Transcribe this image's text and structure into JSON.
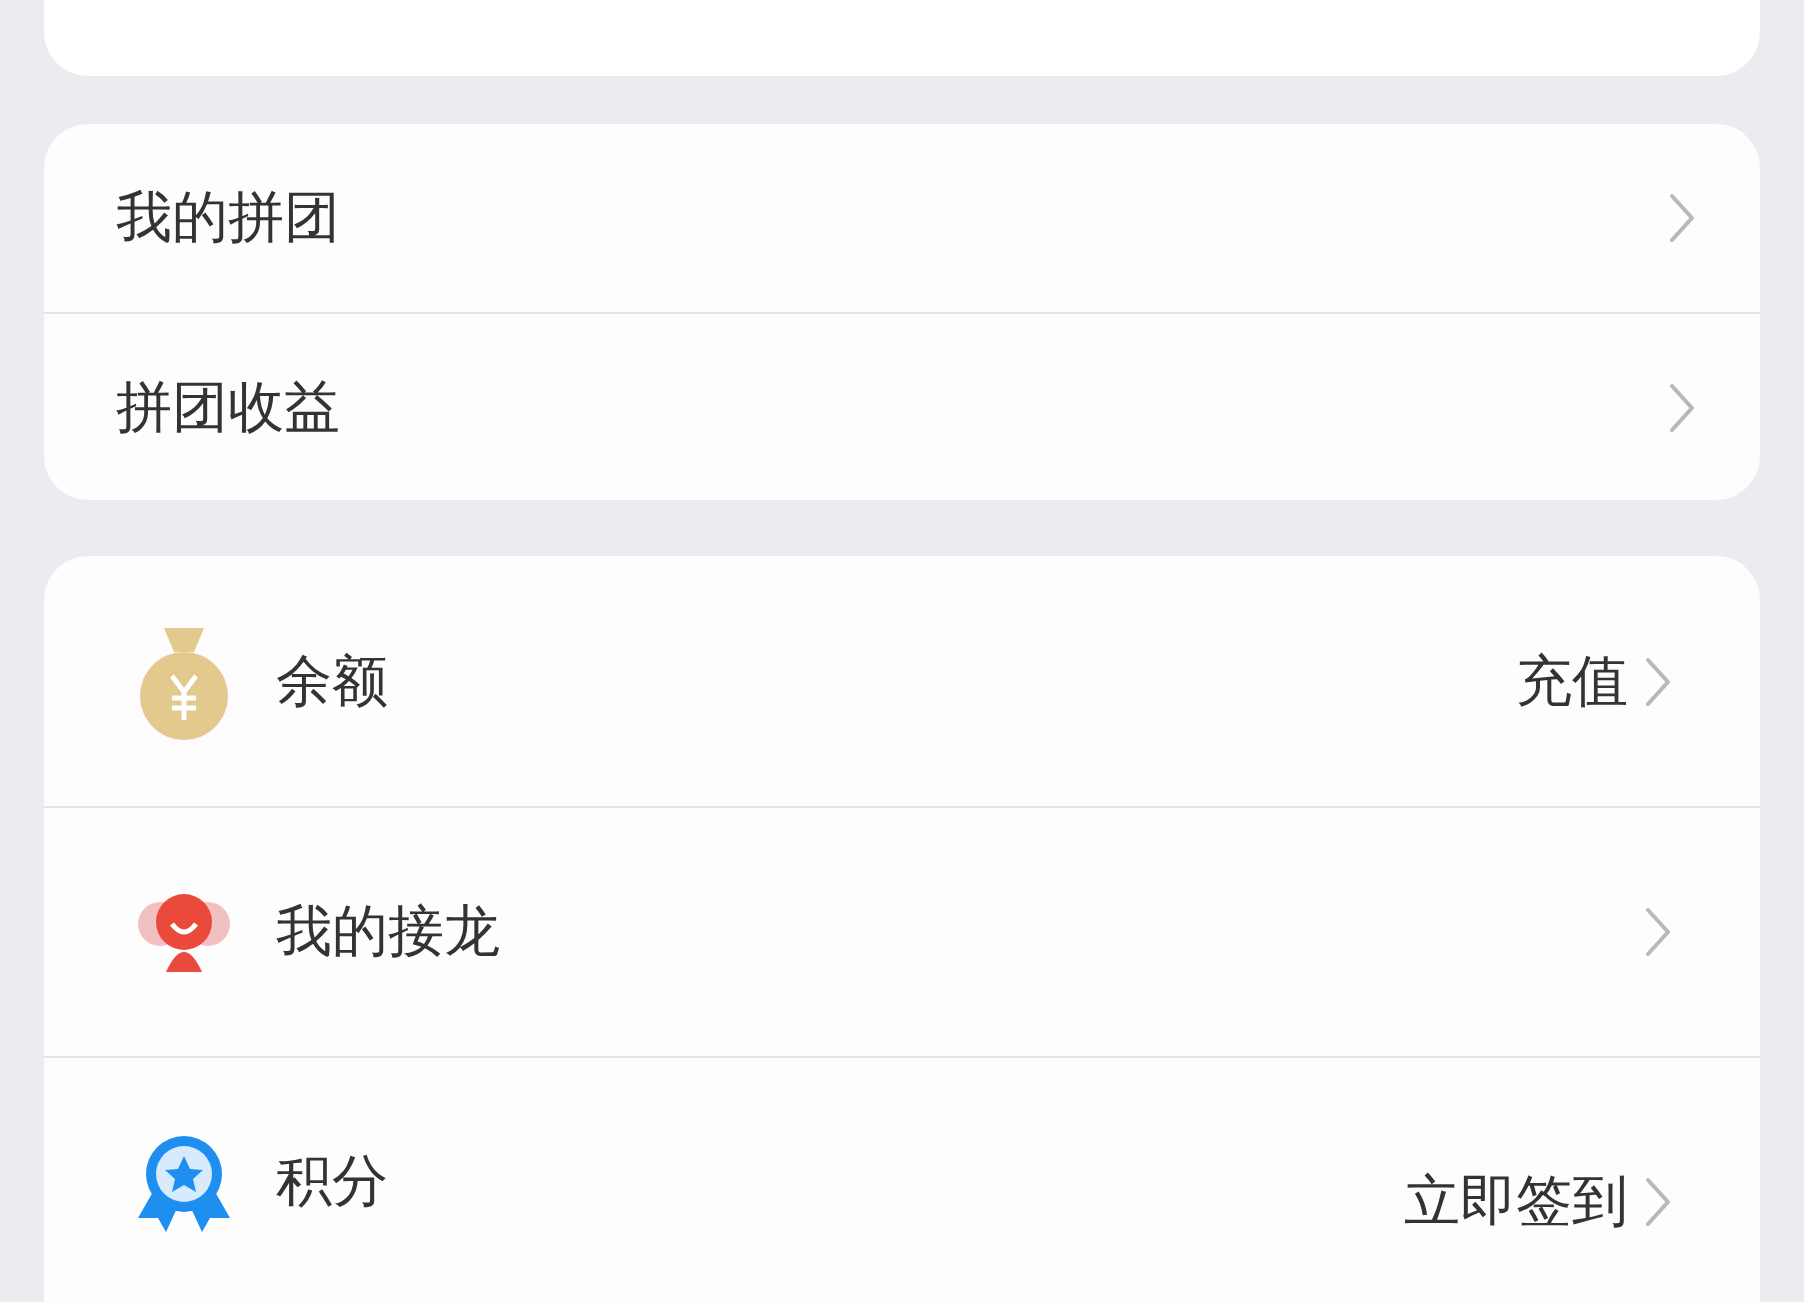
{
  "group_card": {
    "items": [
      {
        "label": "我的拼团"
      },
      {
        "label": "拼团收益"
      }
    ]
  },
  "wallet_card": {
    "items": [
      {
        "kind": "moneybag",
        "label": "余额",
        "action": "充值"
      },
      {
        "kind": "people",
        "label": "我的接龙"
      },
      {
        "kind": "medal",
        "label": "积分",
        "action": "立即签到"
      }
    ]
  }
}
